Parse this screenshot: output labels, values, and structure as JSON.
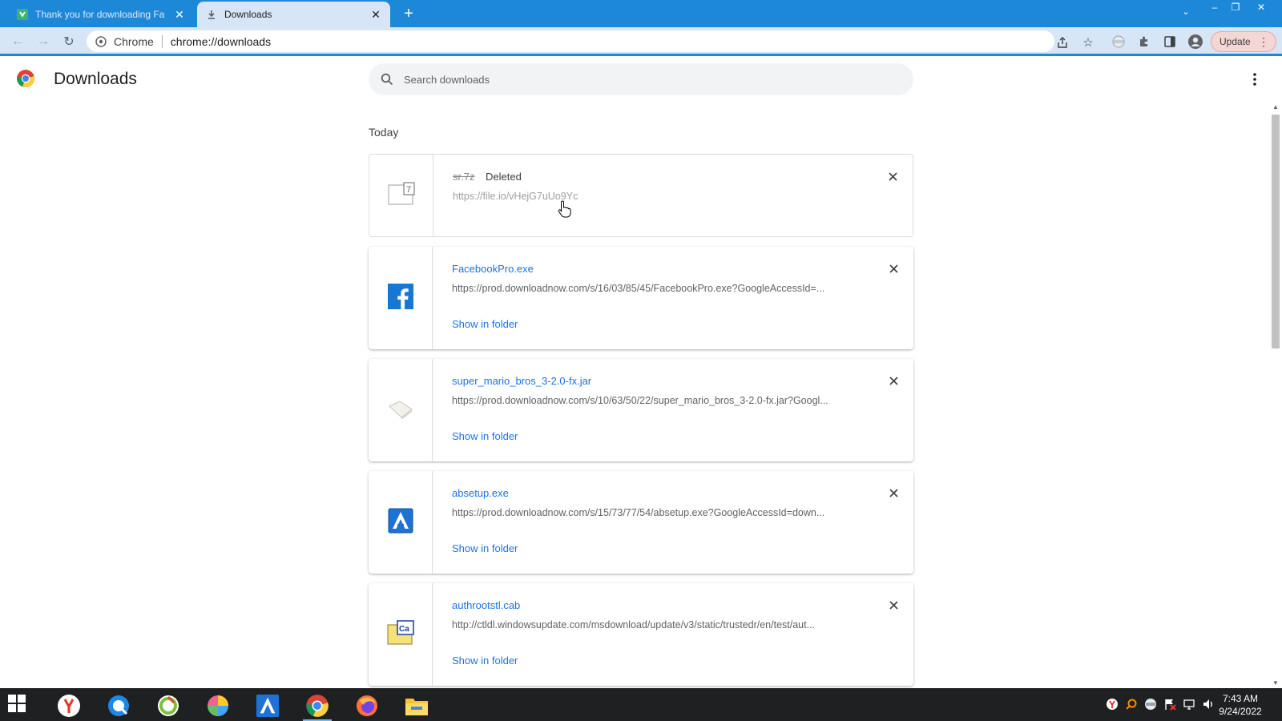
{
  "browser": {
    "tabs": [
      {
        "title": "Thank you for downloading Face",
        "active": false
      },
      {
        "title": "Downloads",
        "active": true
      }
    ],
    "omnibox": {
      "scheme_label": "Chrome",
      "url": "chrome://downloads"
    },
    "update_label": "Update"
  },
  "page": {
    "title": "Downloads",
    "search_placeholder": "Search downloads",
    "section_label": "Today"
  },
  "downloads": [
    {
      "filename": "sr.7z",
      "status": "Deleted",
      "url": "https://file.io/vHejG7uUo9Yc",
      "action": "",
      "icon": "archive-file-icon"
    },
    {
      "filename": "FacebookPro.exe",
      "status": "",
      "url": "https://prod.downloadnow.com/s/16/03/85/45/FacebookPro.exe?GoogleAccessId=...",
      "action": "Show in folder",
      "icon": "facebook-icon"
    },
    {
      "filename": "super_mario_bros_3-2.0-fx.jar",
      "status": "",
      "url": "https://prod.downloadnow.com/s/10/63/50/22/super_mario_bros_3-2.0-fx.jar?Googl...",
      "action": "Show in folder",
      "icon": "jar-file-icon"
    },
    {
      "filename": "absetup.exe",
      "status": "",
      "url": "https://prod.downloadnow.com/s/15/73/77/54/absetup.exe?GoogleAccessId=down...",
      "action": "Show in folder",
      "icon": "absetup-app-icon"
    },
    {
      "filename": "authrootstl.cab",
      "status": "",
      "url": "http://ctldl.windowsupdate.com/msdownload/update/v3/static/trustedr/en/test/aut...",
      "action": "Show in folder",
      "icon": "cab-file-icon"
    }
  ],
  "taskbar": {
    "apps": [
      "yandex-browser-icon",
      "q-browser-icon",
      "ccleaner-icon",
      "colorful-app-icon",
      "absetup-app-icon",
      "chrome-icon",
      "firefox-icon",
      "file-explorer-icon"
    ],
    "clock_time": "7:43 AM",
    "clock_date": "9/24/2022"
  },
  "colors": {
    "tabbar": "#1e88d8",
    "toolbar": "#d6e6f6",
    "link": "#1a73e8",
    "taskbar": "#1f2022"
  }
}
